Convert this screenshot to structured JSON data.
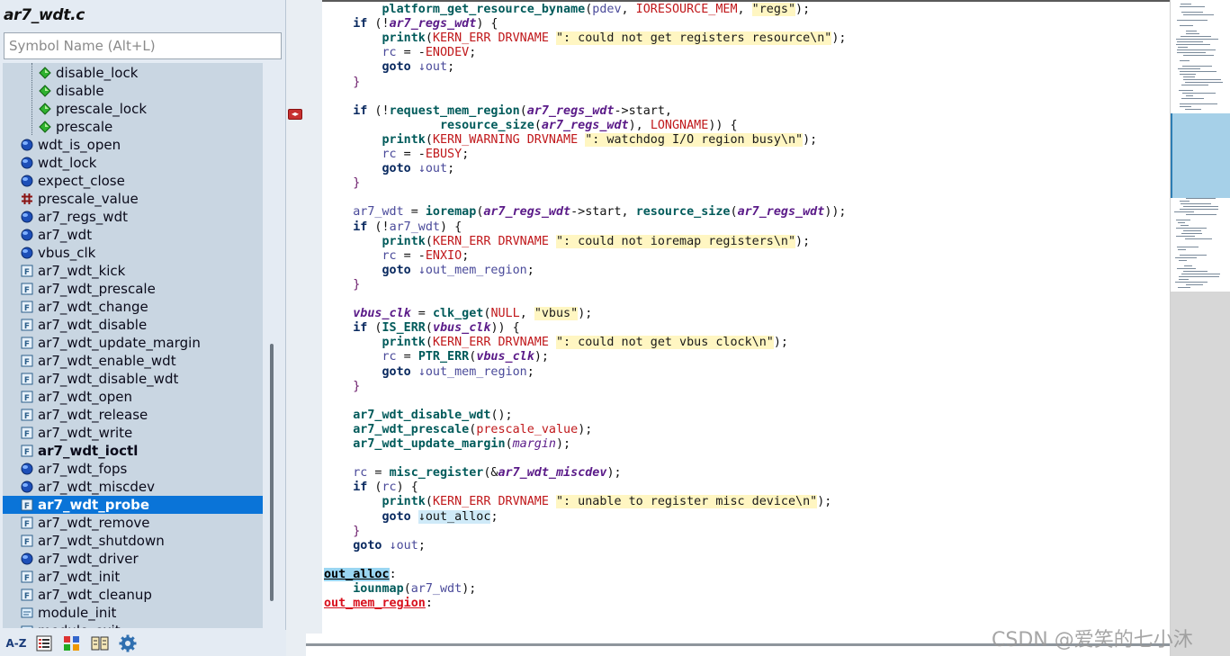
{
  "symbol_window": {
    "file_title": "ar7_wdt.c",
    "search_placeholder": "Symbol Name (Alt+L)",
    "symbols": [
      {
        "label": "disable_lock",
        "icon": "green-diamond-icon",
        "indent": 1
      },
      {
        "label": "disable",
        "icon": "green-diamond-icon",
        "indent": 1
      },
      {
        "label": "prescale_lock",
        "icon": "green-diamond-icon",
        "indent": 1
      },
      {
        "label": "prescale",
        "icon": "green-diamond-icon",
        "indent": 1
      },
      {
        "label": "wdt_is_open",
        "icon": "blue-globe-icon",
        "indent": 0
      },
      {
        "label": "wdt_lock",
        "icon": "blue-globe-icon",
        "indent": 0
      },
      {
        "label": "expect_close",
        "icon": "blue-globe-icon",
        "indent": 0
      },
      {
        "label": "prescale_value",
        "icon": "hash-macro-icon",
        "indent": 0
      },
      {
        "label": "ar7_regs_wdt",
        "icon": "blue-globe-icon",
        "indent": 0
      },
      {
        "label": "ar7_wdt",
        "icon": "blue-globe-icon",
        "indent": 0
      },
      {
        "label": "vbus_clk",
        "icon": "blue-globe-icon",
        "indent": 0
      },
      {
        "label": "ar7_wdt_kick",
        "icon": "function-icon",
        "indent": 0
      },
      {
        "label": "ar7_wdt_prescale",
        "icon": "function-icon",
        "indent": 0
      },
      {
        "label": "ar7_wdt_change",
        "icon": "function-icon",
        "indent": 0
      },
      {
        "label": "ar7_wdt_disable",
        "icon": "function-icon",
        "indent": 0
      },
      {
        "label": "ar7_wdt_update_margin",
        "icon": "function-icon",
        "indent": 0
      },
      {
        "label": "ar7_wdt_enable_wdt",
        "icon": "function-icon",
        "indent": 0
      },
      {
        "label": "ar7_wdt_disable_wdt",
        "icon": "function-icon",
        "indent": 0
      },
      {
        "label": "ar7_wdt_open",
        "icon": "function-icon",
        "indent": 0
      },
      {
        "label": "ar7_wdt_release",
        "icon": "function-icon",
        "indent": 0
      },
      {
        "label": "ar7_wdt_write",
        "icon": "function-icon",
        "indent": 0
      },
      {
        "label": "ar7_wdt_ioctl",
        "icon": "function-icon",
        "indent": 0,
        "bold": true
      },
      {
        "label": "ar7_wdt_fops",
        "icon": "blue-globe-icon",
        "indent": 0
      },
      {
        "label": "ar7_wdt_miscdev",
        "icon": "blue-globe-icon",
        "indent": 0
      },
      {
        "label": "ar7_wdt_probe",
        "icon": "function-icon",
        "indent": 0,
        "selected": true
      },
      {
        "label": "ar7_wdt_remove",
        "icon": "function-icon",
        "indent": 0
      },
      {
        "label": "ar7_wdt_shutdown",
        "icon": "function-icon",
        "indent": 0
      },
      {
        "label": "ar7_wdt_driver",
        "icon": "blue-globe-icon",
        "indent": 0
      },
      {
        "label": "ar7_wdt_init",
        "icon": "function-icon",
        "indent": 0
      },
      {
        "label": "ar7_wdt_cleanup",
        "icon": "function-icon",
        "indent": 0
      },
      {
        "label": "module_init",
        "icon": "macro-ref-icon",
        "indent": 0
      },
      {
        "label": "module_exit",
        "icon": "macro-ref-icon",
        "indent": 0
      }
    ],
    "toolbar": [
      {
        "name": "sort-alphabetical-button",
        "icon": "az-sort-icon",
        "text": "A-Z"
      },
      {
        "name": "list-view-button",
        "icon": "list-icon"
      },
      {
        "name": "category-view-button",
        "icon": "category-icon"
      },
      {
        "name": "browse-button",
        "icon": "book-icon"
      },
      {
        "name": "settings-button",
        "icon": "gear-icon"
      }
    ]
  },
  "editor": {
    "lines": [
      {
        "i": 2,
        "t": [
          [
            "fn-call",
            "platform_get_resource_byname"
          ],
          [
            "p",
            "("
          ],
          [
            "local",
            "pdev"
          ],
          [
            "p",
            ", "
          ],
          [
            "mac",
            "IORESOURCE_MEM"
          ],
          [
            "p",
            ", "
          ],
          [
            "str",
            "\"regs\""
          ],
          [
            "p",
            ");"
          ]
        ]
      },
      {
        "i": 1,
        "t": [
          [
            "kw",
            "if"
          ],
          [
            "p",
            " (!"
          ],
          [
            "var-b",
            "ar7_regs_wdt"
          ],
          [
            "p",
            ") {"
          ]
        ]
      },
      {
        "i": 2,
        "t": [
          [
            "fn-call",
            "printk"
          ],
          [
            "p",
            "("
          ],
          [
            "mac",
            "KERN_ERR DRVNAME "
          ],
          [
            "str",
            "\": could not get registers resource\\n\""
          ],
          [
            "p",
            ");"
          ]
        ]
      },
      {
        "i": 2,
        "t": [
          [
            "local",
            "rc"
          ],
          [
            "p",
            " = -"
          ],
          [
            "mac",
            "ENODEV"
          ],
          [
            "p",
            ";"
          ]
        ]
      },
      {
        "i": 2,
        "t": [
          [
            "kw",
            "goto"
          ],
          [
            "p",
            " "
          ],
          [
            "local",
            "↓out"
          ],
          [
            "p",
            ";"
          ]
        ]
      },
      {
        "i": 1,
        "t": [
          [
            "brace",
            "}"
          ]
        ]
      },
      {
        "i": 0,
        "t": []
      },
      {
        "i": 1,
        "t": [
          [
            "kw",
            "if"
          ],
          [
            "p",
            " (!"
          ],
          [
            "fn-call",
            "request_mem_region"
          ],
          [
            "p",
            "("
          ],
          [
            "var-b",
            "ar7_regs_wdt"
          ],
          [
            "p",
            "->start,"
          ]
        ]
      },
      {
        "i": 4,
        "t": [
          [
            "fn-call",
            "resource_size"
          ],
          [
            "p",
            "("
          ],
          [
            "var-b",
            "ar7_regs_wdt"
          ],
          [
            "p",
            "), "
          ],
          [
            "mac",
            "LONGNAME"
          ],
          [
            "p",
            ")) {"
          ]
        ]
      },
      {
        "i": 2,
        "t": [
          [
            "fn-call",
            "printk"
          ],
          [
            "p",
            "("
          ],
          [
            "mac",
            "KERN_WARNING DRVNAME "
          ],
          [
            "str",
            "\": watchdog I/O region busy\\n\""
          ],
          [
            "p",
            ");"
          ]
        ]
      },
      {
        "i": 2,
        "t": [
          [
            "local",
            "rc"
          ],
          [
            "p",
            " = -"
          ],
          [
            "mac",
            "EBUSY"
          ],
          [
            "p",
            ";"
          ]
        ]
      },
      {
        "i": 2,
        "t": [
          [
            "kw",
            "goto"
          ],
          [
            "p",
            " "
          ],
          [
            "local",
            "↓out"
          ],
          [
            "p",
            ";"
          ]
        ]
      },
      {
        "i": 1,
        "t": [
          [
            "brace",
            "}"
          ]
        ]
      },
      {
        "i": 0,
        "t": []
      },
      {
        "i": 1,
        "t": [
          [
            "local",
            "ar7_wdt"
          ],
          [
            "p",
            " = "
          ],
          [
            "fn-call",
            "ioremap"
          ],
          [
            "p",
            "("
          ],
          [
            "var-b",
            "ar7_regs_wdt"
          ],
          [
            "p",
            "->start, "
          ],
          [
            "fn-call",
            "resource_size"
          ],
          [
            "p",
            "("
          ],
          [
            "var-b",
            "ar7_regs_wdt"
          ],
          [
            "p",
            "));"
          ]
        ]
      },
      {
        "i": 1,
        "t": [
          [
            "kw",
            "if"
          ],
          [
            "p",
            " (!"
          ],
          [
            "local",
            "ar7_wdt"
          ],
          [
            "p",
            ") {"
          ]
        ]
      },
      {
        "i": 2,
        "t": [
          [
            "fn-call",
            "printk"
          ],
          [
            "p",
            "("
          ],
          [
            "mac",
            "KERN_ERR DRVNAME "
          ],
          [
            "str",
            "\": could not ioremap registers\\n\""
          ],
          [
            "p",
            ");"
          ]
        ]
      },
      {
        "i": 2,
        "t": [
          [
            "local",
            "rc"
          ],
          [
            "p",
            " = -"
          ],
          [
            "mac",
            "ENXIO"
          ],
          [
            "p",
            ";"
          ]
        ]
      },
      {
        "i": 2,
        "t": [
          [
            "kw",
            "goto"
          ],
          [
            "p",
            " "
          ],
          [
            "local",
            "↓out_mem_region"
          ],
          [
            "p",
            ";"
          ]
        ]
      },
      {
        "i": 1,
        "t": [
          [
            "brace",
            "}"
          ]
        ]
      },
      {
        "i": 0,
        "t": []
      },
      {
        "i": 1,
        "t": [
          [
            "var-b",
            "vbus_clk"
          ],
          [
            "p",
            " = "
          ],
          [
            "fn-call",
            "clk_get"
          ],
          [
            "p",
            "("
          ],
          [
            "mac",
            "NULL"
          ],
          [
            "p",
            ", "
          ],
          [
            "str",
            "\"vbus\""
          ],
          [
            "p",
            ");"
          ]
        ]
      },
      {
        "i": 1,
        "t": [
          [
            "kw",
            "if"
          ],
          [
            "p",
            " ("
          ],
          [
            "fn-call",
            "IS_ERR"
          ],
          [
            "p",
            "("
          ],
          [
            "var-b",
            "vbus_clk"
          ],
          [
            "p",
            ")) {"
          ]
        ]
      },
      {
        "i": 2,
        "t": [
          [
            "fn-call",
            "printk"
          ],
          [
            "p",
            "("
          ],
          [
            "mac",
            "KERN_ERR DRVNAME "
          ],
          [
            "str",
            "\": could not get vbus clock\\n\""
          ],
          [
            "p",
            ");"
          ]
        ]
      },
      {
        "i": 2,
        "t": [
          [
            "local",
            "rc"
          ],
          [
            "p",
            " = "
          ],
          [
            "fn-call",
            "PTR_ERR"
          ],
          [
            "p",
            "("
          ],
          [
            "var-b",
            "vbus_clk"
          ],
          [
            "p",
            ");"
          ]
        ]
      },
      {
        "i": 2,
        "t": [
          [
            "kw",
            "goto"
          ],
          [
            "p",
            " "
          ],
          [
            "local",
            "↓out_mem_region"
          ],
          [
            "p",
            ";"
          ]
        ]
      },
      {
        "i": 1,
        "t": [
          [
            "brace",
            "}"
          ]
        ]
      },
      {
        "i": 0,
        "t": []
      },
      {
        "i": 1,
        "t": [
          [
            "fn-call",
            "ar7_wdt_disable_wdt"
          ],
          [
            "p",
            "();"
          ]
        ]
      },
      {
        "i": 1,
        "t": [
          [
            "fn-call",
            "ar7_wdt_prescale"
          ],
          [
            "p",
            "("
          ],
          [
            "mac",
            "prescale_value"
          ],
          [
            "p",
            ");"
          ]
        ]
      },
      {
        "i": 1,
        "t": [
          [
            "fn-call",
            "ar7_wdt_update_margin"
          ],
          [
            "p",
            "("
          ],
          [
            "var",
            "margin"
          ],
          [
            "p",
            ");"
          ]
        ]
      },
      {
        "i": 0,
        "t": []
      },
      {
        "i": 1,
        "t": [
          [
            "local",
            "rc"
          ],
          [
            "p",
            " = "
          ],
          [
            "fn-call",
            "misc_register"
          ],
          [
            "p",
            "(&"
          ],
          [
            "var-b",
            "ar7_wdt_miscdev"
          ],
          [
            "p",
            ");"
          ]
        ]
      },
      {
        "i": 1,
        "t": [
          [
            "kw",
            "if"
          ],
          [
            "p",
            " ("
          ],
          [
            "local",
            "rc"
          ],
          [
            "p",
            ") {"
          ]
        ]
      },
      {
        "i": 2,
        "t": [
          [
            "fn-call",
            "printk"
          ],
          [
            "p",
            "("
          ],
          [
            "mac",
            "KERN_ERR DRVNAME "
          ],
          [
            "str",
            "\": unable to register misc device\\n\""
          ],
          [
            "p",
            ");"
          ]
        ]
      },
      {
        "i": 2,
        "t": [
          [
            "kw",
            "goto"
          ],
          [
            "p",
            " "
          ],
          [
            "goto-hl",
            "↓out_alloc"
          ],
          [
            "p",
            ";"
          ]
        ]
      },
      {
        "i": 1,
        "t": [
          [
            "brace",
            "}"
          ]
        ]
      },
      {
        "i": 1,
        "t": [
          [
            "kw",
            "goto"
          ],
          [
            "p",
            " "
          ],
          [
            "local",
            "↓out"
          ],
          [
            "p",
            ";"
          ]
        ]
      },
      {
        "i": 0,
        "t": []
      },
      {
        "i": 0,
        "t": [
          [
            "label-hl",
            "out_alloc"
          ],
          [
            "p",
            ":"
          ]
        ]
      },
      {
        "i": 1,
        "t": [
          [
            "fn-call",
            "iounmap"
          ],
          [
            "p",
            "("
          ],
          [
            "local",
            "ar7_wdt"
          ],
          [
            "p",
            ");"
          ]
        ]
      },
      {
        "i": 0,
        "t": [
          [
            "label",
            "out_mem_region"
          ],
          [
            "p",
            ":"
          ]
        ]
      }
    ]
  },
  "splitter_handle_label": "◂▸",
  "watermark": "CSDN @爱笑的七小沐",
  "colors": {
    "selection": "#0a74d8",
    "symbol_list_bg": "#c9d6e2",
    "string_highlight": "#fff6c2",
    "label_red": "#d8101d",
    "minimap_view": "#a6d0e8"
  }
}
